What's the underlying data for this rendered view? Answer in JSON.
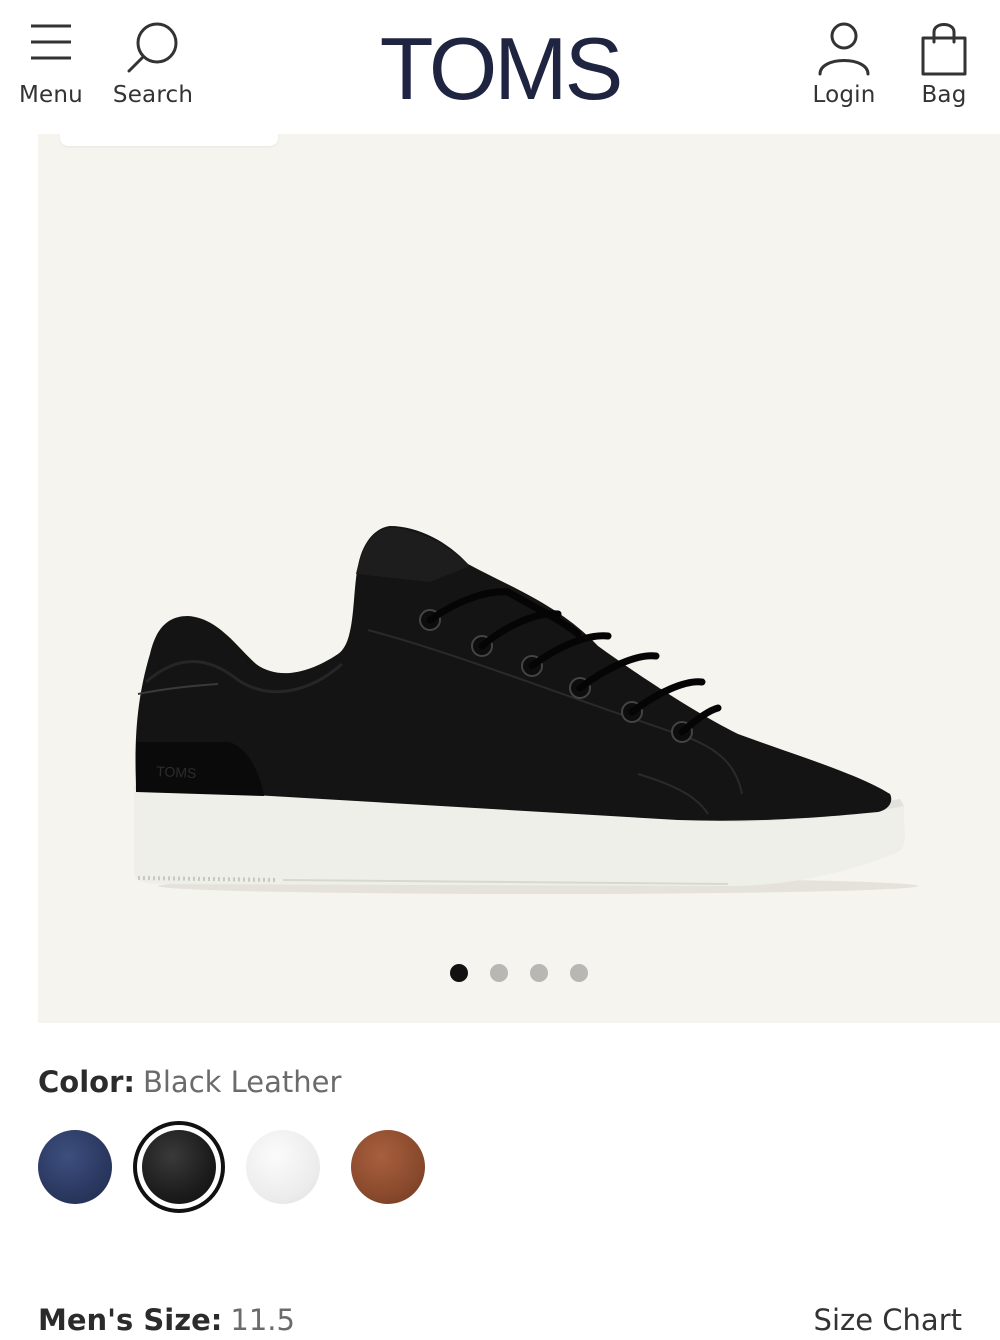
{
  "header": {
    "menu_label": "Menu",
    "search_label": "Search",
    "logo_text": "TOMS",
    "login_label": "Login",
    "bag_label": "Bag"
  },
  "gallery": {
    "slide_count": 4,
    "active_index": 0,
    "background_color": "#f5f4ee"
  },
  "color": {
    "label": "Color:",
    "selected": "Black Leather",
    "swatches": [
      {
        "name": "navy",
        "color": "#2c3a63",
        "selected": false
      },
      {
        "name": "black",
        "color": "#1c1c1c",
        "selected": true
      },
      {
        "name": "white",
        "color": "#ececec",
        "selected": false
      },
      {
        "name": "brown",
        "color": "#8a4a2d",
        "selected": false
      }
    ]
  },
  "size": {
    "label": "Men's Size:",
    "selected": "11.5",
    "chart_link": "Size Chart"
  },
  "colors": {
    "logo": "#1f2440",
    "active_dot": "#111111",
    "inactive_dot": "#b7b7b3"
  }
}
